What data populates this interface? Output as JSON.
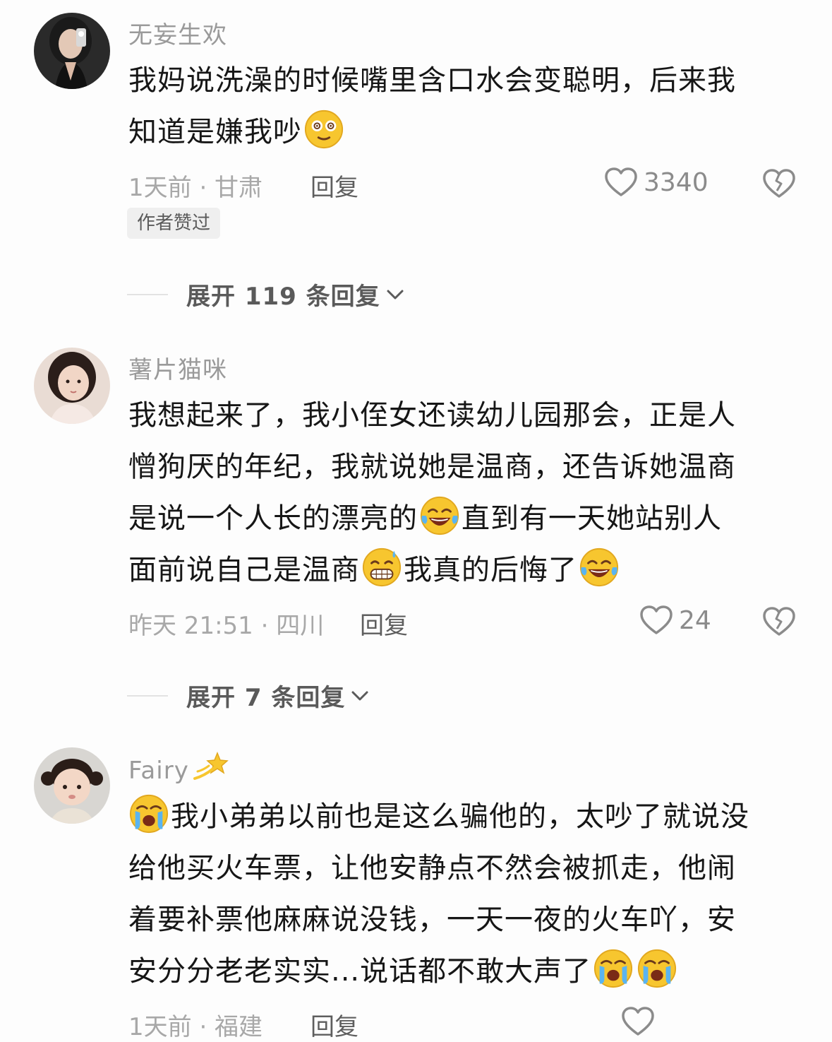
{
  "comments": [
    {
      "username": "无妄生欢",
      "lines": [
        "我妈说洗澡的时候嘴里含口水会变聪明，后来我",
        "知道是嫌我吵"
      ],
      "emojis_after_text": [
        "dizzy-face-emoji"
      ],
      "time_location": "1天前 · 甘肃",
      "reply_label": "回复",
      "like_count": "3340",
      "badge": "作者赞过",
      "expand_label": "展开 119 条回复"
    },
    {
      "username": "薯片猫咪",
      "lines": [
        "我想起来了，我小侄女还读幼儿园那会，正是人",
        "憎狗厌的年纪，我就说她是温商，还告诉她温商",
        "是说一个人长的漂亮的",
        "直到有一天她站别人",
        "面前说自己是温商",
        "我真的后悔了"
      ],
      "time_location": "昨天 21:51 · 四川",
      "reply_label": "回复",
      "like_count": "24",
      "expand_label": "展开 7 条回复"
    },
    {
      "username": "Fairy",
      "lines": [
        "我小弟弟以前也是这么骗他的，太吵了就说没",
        "给他买火车票，让他安静点不然会被抓走，他闹",
        "着要补票他麻麻说没钱，一天一夜的火车吖，安",
        "安分分老老实实...说话都不敢大声了"
      ],
      "time_location": "1天前 · 福建",
      "reply_label": "回复"
    }
  ],
  "colors": {
    "background": "#fdfdfd",
    "text": "#161616",
    "muted": "#a8a8a8",
    "emoji_yellow": "#f7c62f"
  }
}
